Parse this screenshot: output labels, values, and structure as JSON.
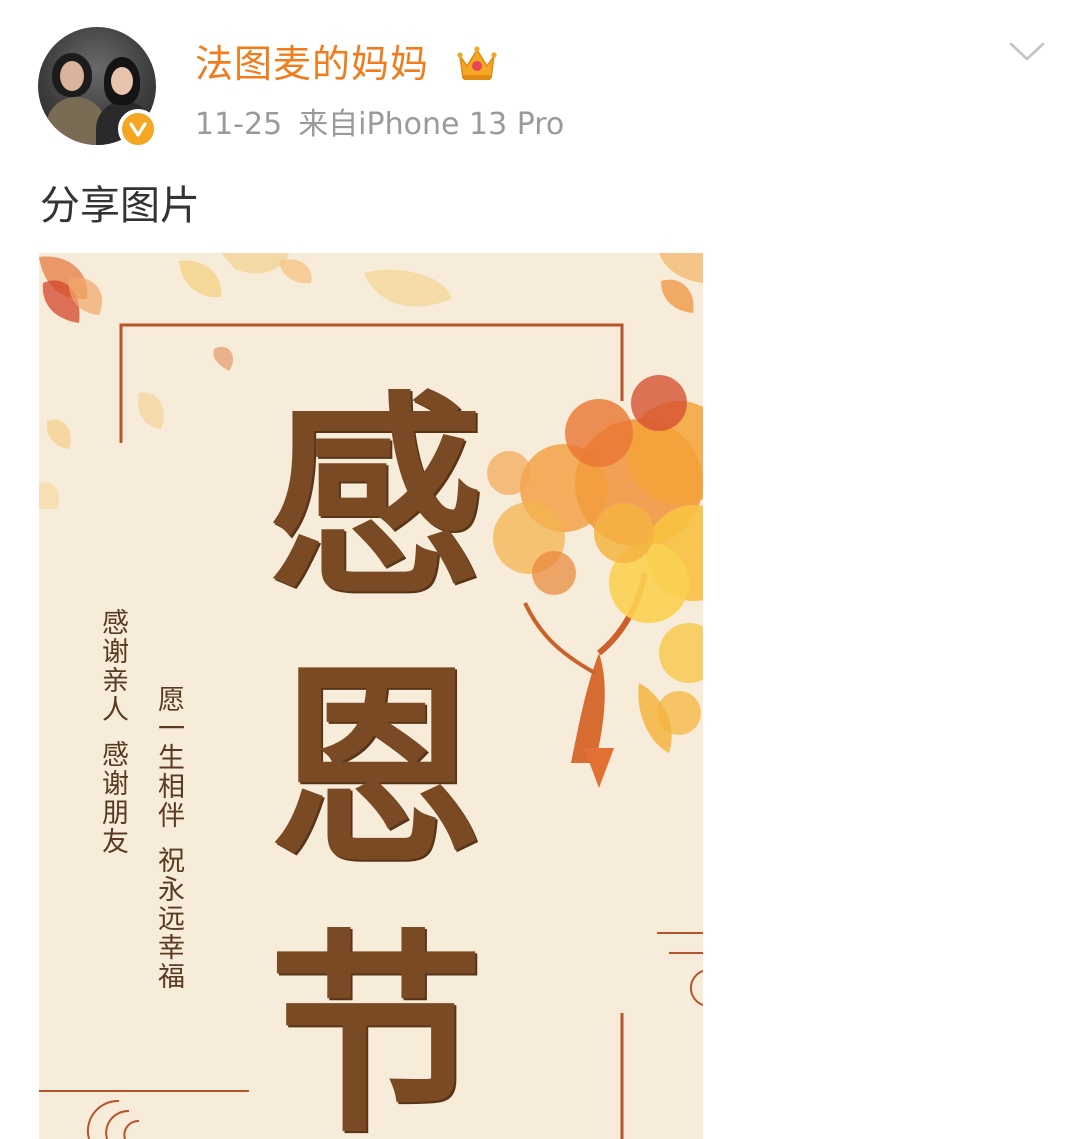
{
  "post": {
    "author": "法图麦的妈妈",
    "date": "11-25",
    "source": "来自iPhone 13 Pro",
    "text": "分享图片"
  },
  "poster": {
    "title_chars": [
      "感",
      "恩",
      "节"
    ],
    "line1_a": "感谢亲人",
    "line1_b": "感谢朋友",
    "line2_a": "愿一生相伴",
    "line2_b": "祝永远幸福"
  },
  "colors": {
    "name": "#f07c1b",
    "meta": "#9a9a9a",
    "verified": "#f5a623",
    "poster_bg": "#f7ecd9",
    "title_brown": "#7a4a24"
  },
  "icons": {
    "verified": "verified-badge-icon",
    "crown": "crown-icon",
    "chevron": "chevron-down-icon"
  }
}
